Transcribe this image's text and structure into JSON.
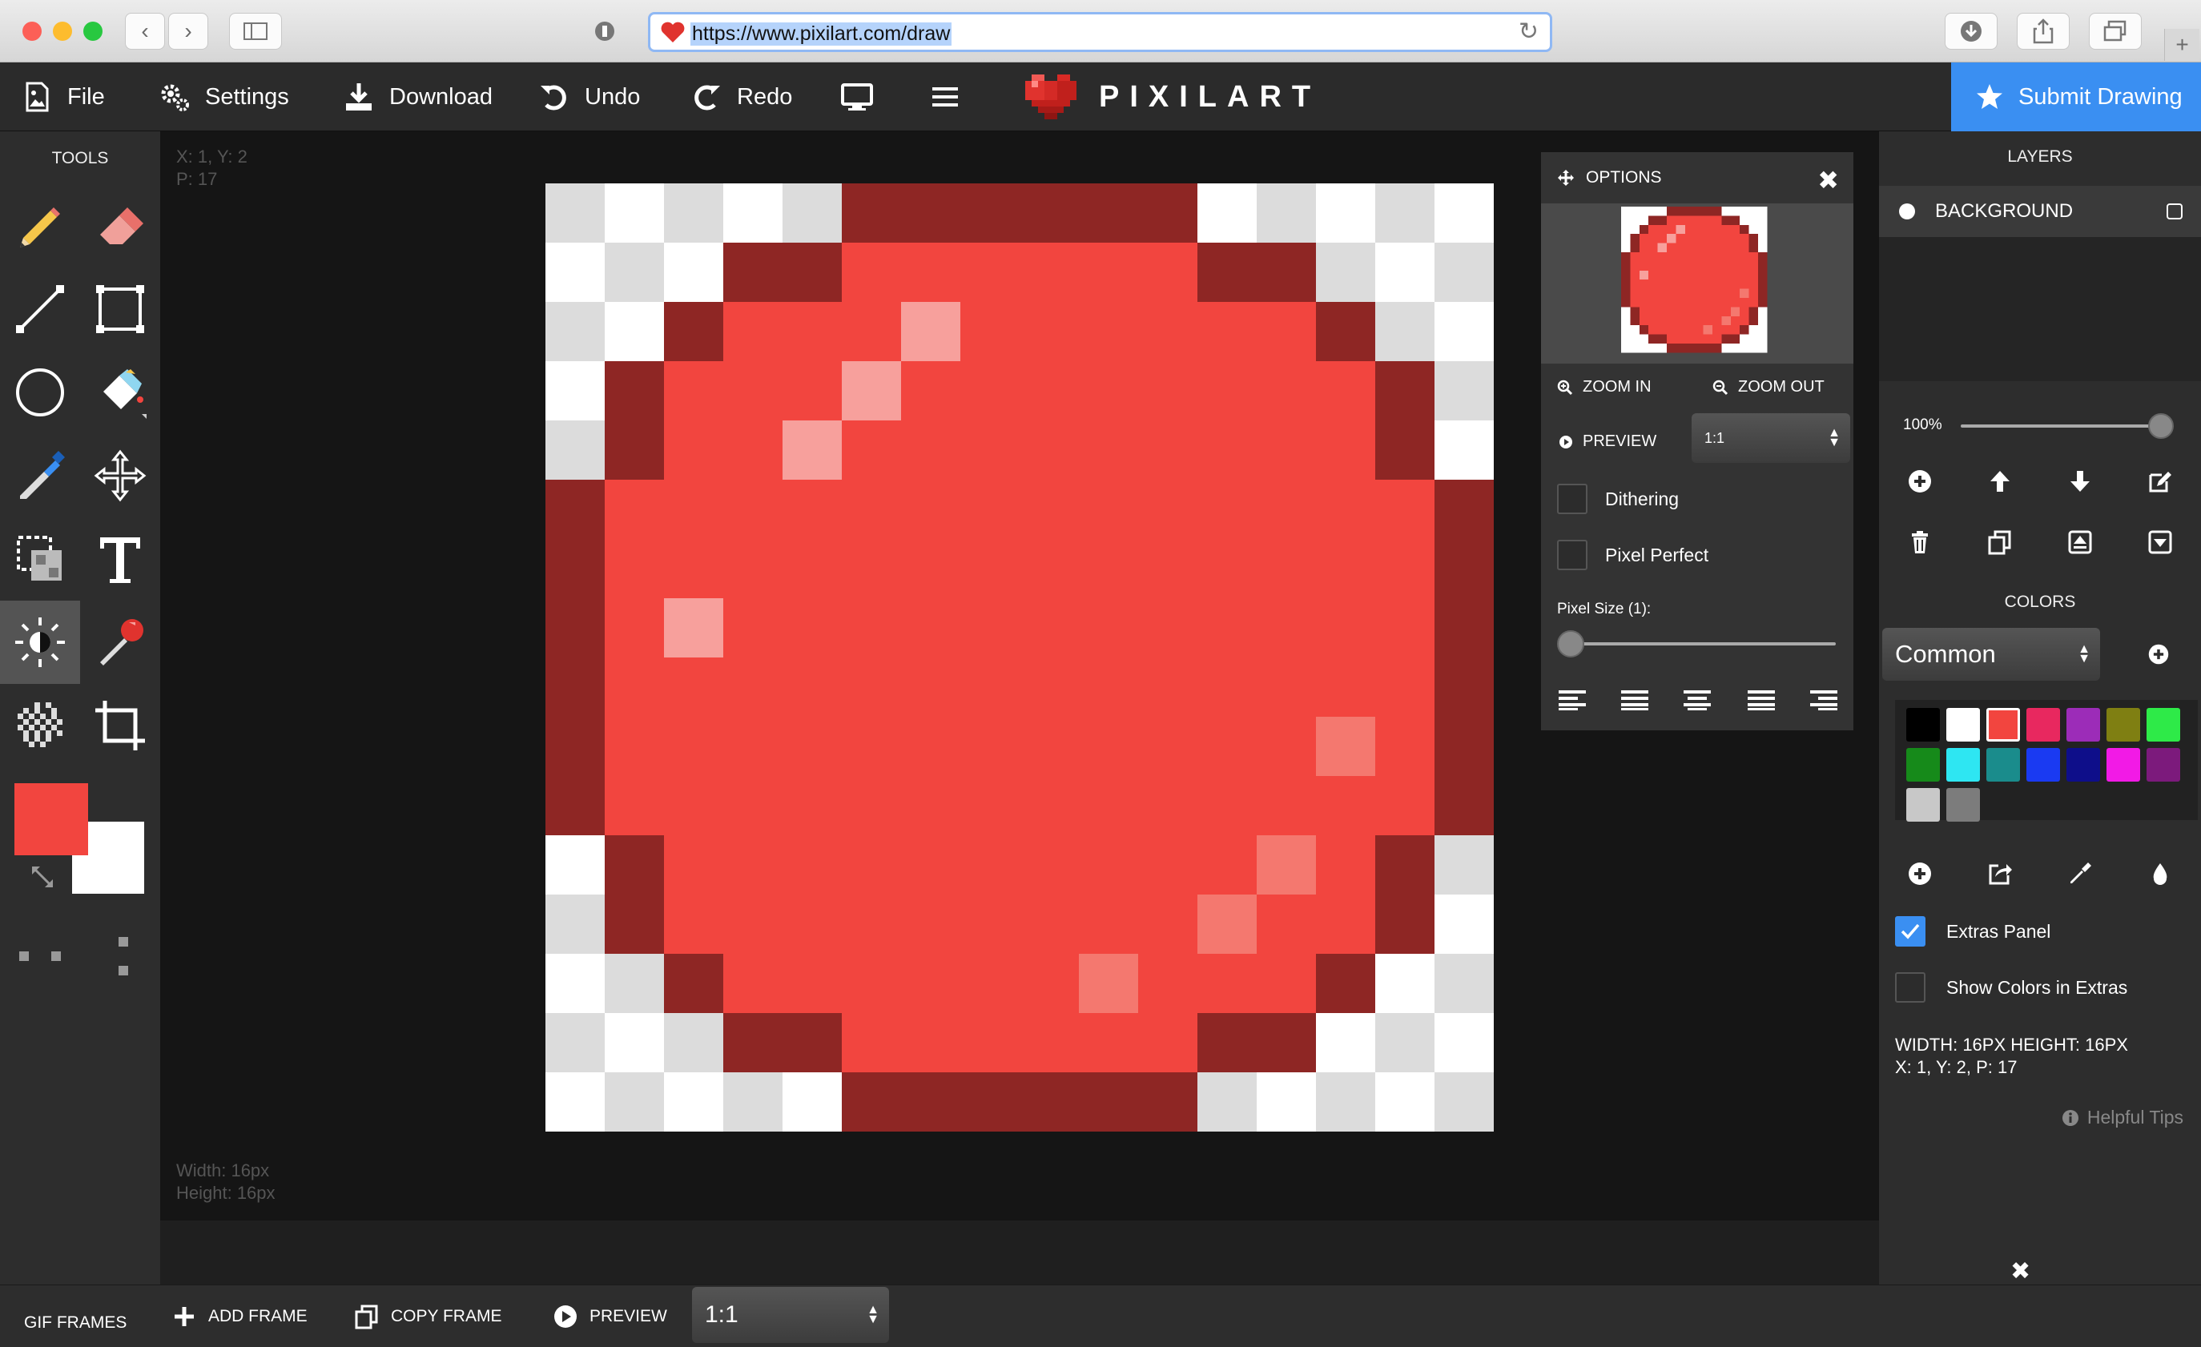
{
  "browser": {
    "url": "https://www.pixilart.com/draw",
    "traffic_lights": [
      "#fc5f57",
      "#fdbc2e",
      "#28c840"
    ]
  },
  "topbar": {
    "file": "File",
    "settings": "Settings",
    "download": "Download",
    "undo": "Undo",
    "redo": "Redo",
    "logo": "PIXILART",
    "submit": "Submit Drawing"
  },
  "tools": {
    "title": "TOOLS",
    "items": [
      "pencil",
      "eraser",
      "line",
      "rectangle",
      "circle",
      "paint-bucket",
      "eyedropper",
      "move",
      "selection",
      "text",
      "lighten",
      "color-replace",
      "dither",
      "crop"
    ],
    "active": "lighten",
    "primary_color": "#f2453f",
    "secondary_color": "#ffffff"
  },
  "workspace": {
    "coords_line1": "X: 1, Y: 2",
    "coords_line2": "P: 17",
    "width_label": "Width: 16px",
    "height_label": "Height: 16px"
  },
  "drawing": {
    "size": 16,
    "colors": {
      "dark": "#8e2624",
      "red": "#f2453f",
      "light": "#f7a09c",
      "mid": "#f4786f"
    }
  },
  "options": {
    "title": "OPTIONS",
    "zoom_in": "ZOOM IN",
    "zoom_out": "ZOOM OUT",
    "preview": "PREVIEW",
    "preview_ratio": "1:1",
    "dithering": "Dithering",
    "pixel_perfect": "Pixel Perfect",
    "pixel_size_label": "Pixel Size (1):",
    "pixel_size_value": 1
  },
  "layers": {
    "title": "LAYERS",
    "items": [
      {
        "name": "BACKGROUND"
      }
    ],
    "opacity_label": "100%",
    "opacity_value": 1.0,
    "colors_title": "COLORS",
    "palette_name": "Common",
    "palette": [
      "#000000",
      "#ffffff",
      "#f2453f",
      "#e8285f",
      "#9c2cb8",
      "#7f7f12",
      "#2eea48",
      "#168a1a",
      "#2ee6f2",
      "#1a8c8c",
      "#1a3af2",
      "#0e0e8a",
      "#f21ae6",
      "#7c1a7c",
      "#c8c8c8",
      "#7c7c7c"
    ],
    "selected_color_index": 2,
    "extras_panel": "Extras Panel",
    "extras_panel_checked": true,
    "show_colors": "Show Colors in Extras",
    "show_colors_checked": false,
    "size_info": "WIDTH: 16PX HEIGHT: 16PX",
    "coord_info": "X: 1, Y: 2, P: 17",
    "helpful_tips": "Helpful Tips"
  },
  "bottom": {
    "gif_frames": "GIF FRAMES",
    "add_frame": "ADD FRAME",
    "copy_frame": "COPY FRAME",
    "preview": "PREVIEW",
    "ratio": "1:1"
  }
}
